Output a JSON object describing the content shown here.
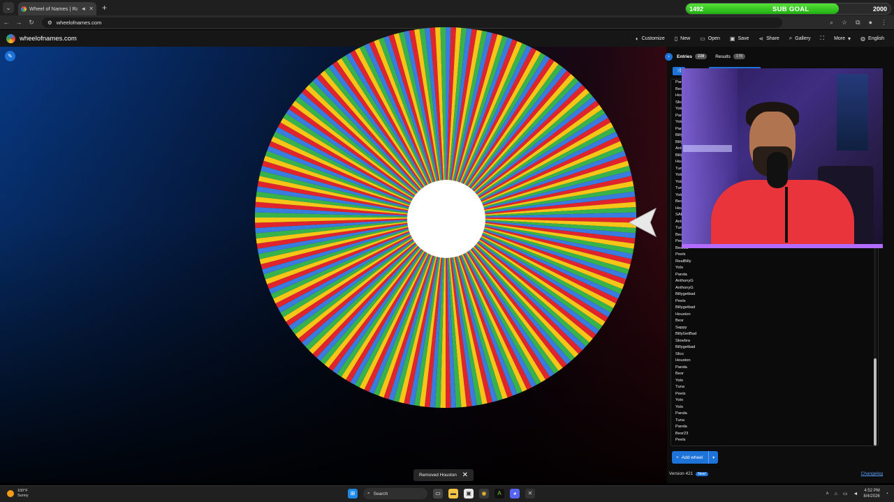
{
  "browser": {
    "tab_title": "Wheel of Names | Random",
    "url": "wheelofnames.com"
  },
  "overlay": {
    "sub_goal_label": "SUB GOAL",
    "current": "1492",
    "goal": "2000",
    "progress_fraction": 0.746
  },
  "app": {
    "title": "wheelofnames.com",
    "menu": [
      {
        "label": "Customize",
        "icon": "palette-icon"
      },
      {
        "label": "New",
        "icon": "new-file-icon"
      },
      {
        "label": "Open",
        "icon": "folder-open-icon"
      },
      {
        "label": "Save",
        "icon": "save-icon"
      },
      {
        "label": "Share",
        "icon": "share-icon"
      },
      {
        "label": "Gallery",
        "icon": "search-icon"
      },
      {
        "label": "",
        "icon": "fullscreen-icon"
      },
      {
        "label": "More",
        "icon": "chevron-down-icon"
      },
      {
        "label": "English",
        "icon": "globe-icon"
      }
    ]
  },
  "wheel": {
    "colors": [
      "#e0242e",
      "#f5c518",
      "#38b24a",
      "#3a7be0"
    ],
    "segment_count": 228
  },
  "panel": {
    "tabs": [
      {
        "label": "Entries",
        "count": "228",
        "active": true
      },
      {
        "label": "Results",
        "count": "178",
        "active": false
      }
    ],
    "entries": [
      "Pan",
      "Bes",
      "Hou",
      "Slic",
      "Yolo",
      "Pan",
      "Yolo",
      "Pan",
      "Billy",
      "Billy",
      "Ant",
      "Billy",
      "Hou",
      "Tun",
      "Yolo",
      "Yolo",
      "Tun",
      "Yolo",
      "Bes",
      "Hou",
      "SAF",
      "Ant",
      "Tun",
      "Bea",
      "Peels",
      "Besr23",
      "Peels",
      "RealBilly",
      "Yolo",
      "Panda",
      "AnthonyG",
      "AnthonyG",
      "Billygetbad",
      "Peels",
      "Billygetbad",
      "Houston",
      "Besr",
      "Sappy",
      "BillyGetBad",
      "Slowbra",
      "Billygetbad",
      "Slicc",
      "Houston",
      "Panda",
      "Besr",
      "Yolo",
      "Tuna",
      "Peels",
      "Yolo",
      "Yolo",
      "Panda",
      "Tuna",
      "Panda",
      "Besr23",
      "Peels"
    ],
    "add_wheel_label": "Add wheel",
    "version": "Version 421",
    "new_badge": "New!",
    "changelog": "Changelog"
  },
  "snackbar": {
    "message": "Removed Houston"
  },
  "taskbar": {
    "temp": "100°F",
    "condition": "Sunny",
    "search_placeholder": "Search",
    "time": "4:52 PM",
    "date": "8/4/2026"
  }
}
